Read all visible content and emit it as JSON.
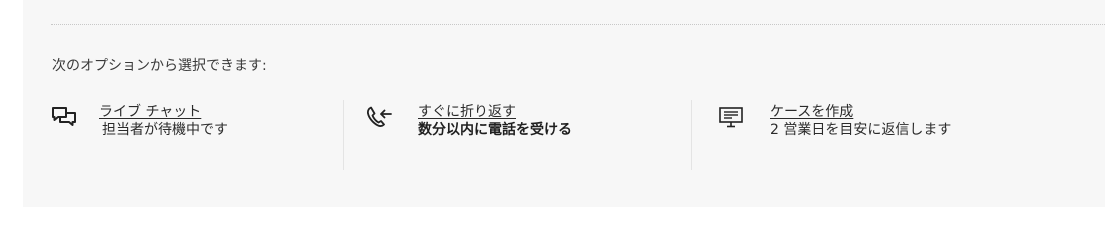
{
  "intro": "次のオプションから選択できます:",
  "options": [
    {
      "link": "ライブ チャット",
      "sub": "担当者が待機中です",
      "icon": "chat-bubbles-icon"
    },
    {
      "link": "すぐに折り返す",
      "sub": "数分以内に電話を受ける",
      "icon": "phone-callback-icon"
    },
    {
      "link": "ケースを作成",
      "sub": "2 営業日を目安に返信します",
      "icon": "monitor-case-icon"
    }
  ],
  "colors": {
    "panel_bg": "#f7f7f7",
    "text": "#2b2b2b",
    "divider": "#c8c8c8"
  }
}
